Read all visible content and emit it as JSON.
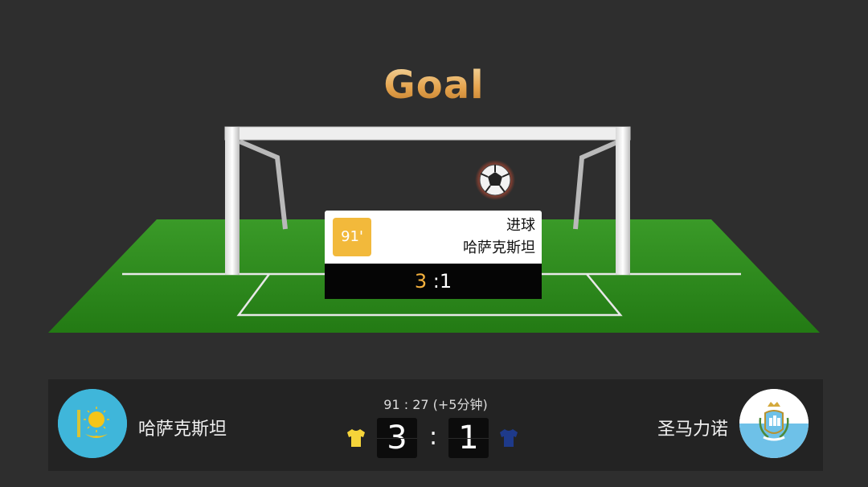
{
  "title": "Goal",
  "event": {
    "minute": "91'",
    "type": "进球",
    "team": "哈萨克斯坦",
    "score_home": "3",
    "score_away": ":1"
  },
  "scoreboard": {
    "home": {
      "name": "哈萨克斯坦",
      "score": "3",
      "kit_color": "#f5d43a",
      "flag_colors": [
        "#3fb6da",
        "#f5c518"
      ]
    },
    "away": {
      "name": "圣马力诺",
      "score": "1",
      "kit_color": "#1e3a8a",
      "flag_colors": [
        "#ffffff",
        "#6ec1e8"
      ]
    },
    "separator": ":",
    "clock": "91 : 27    (+5分钟)"
  },
  "colors": {
    "background": "#2e2e2e",
    "pitch": "#2f8a1f",
    "title_gold": "#e5a44e",
    "badge_yellow": "#f2b93b"
  },
  "icons": [
    "soccer-ball-icon",
    "home-kit-icon",
    "away-kit-icon",
    "kazakhstan-flag-icon",
    "san-marino-flag-icon"
  ]
}
